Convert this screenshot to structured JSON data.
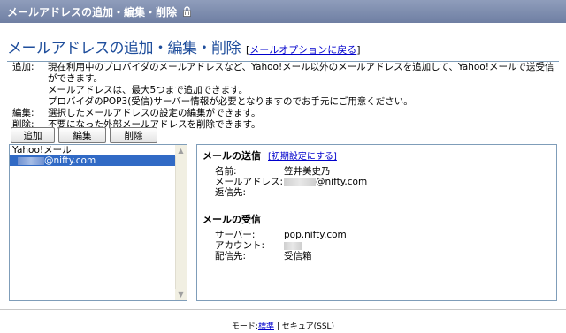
{
  "window": {
    "title": "メールアドレスの追加・編集・削除"
  },
  "heading": {
    "title": "メールアドレスの追加・編集・削除",
    "back_bracket_open": "[",
    "back_link": "メールオプションに戻る",
    "back_bracket_close": "]"
  },
  "description": [
    {
      "label": "追加:",
      "lines": [
        "現在利用中のプロバイダのメールアドレスなど、Yahoo!メール以外のメールアドレスを追加して、Yahoo!メールで送受信ができます。",
        "メールアドレスは、最大5つまで追加できます。",
        "プロバイダのPOP3(受信)サーバー情報が必要となりますのでお手元にご用意ください。"
      ]
    },
    {
      "label": "編集:",
      "lines": [
        "選択したメールアドレスの設定の編集ができます。"
      ]
    },
    {
      "label": "削除:",
      "lines": [
        "不要になった外部メールアドレスを削除できます。"
      ]
    }
  ],
  "toolbar": {
    "add_label": "追加",
    "edit_label": "編集",
    "delete_label": "削除"
  },
  "accounts": {
    "items": [
      {
        "label": "Yahoo!メール",
        "suffix": ""
      },
      {
        "label": "",
        "suffix": "@nifty.com"
      }
    ],
    "selected_index": 1
  },
  "send": {
    "title": "メールの送信",
    "reset_link": "[初期設定にする]",
    "name_label": "名前:",
    "name_value": "笠井美史乃",
    "address_label": "メールアドレス:",
    "address_value": "@nifty.com",
    "reply_label": "返信先:",
    "reply_value": ""
  },
  "receive": {
    "title": "メールの受信",
    "server_label": "サーバー:",
    "server_value": "pop.nifty.com",
    "account_label": "アカウント:",
    "account_value": "",
    "folder_label": "配信先:",
    "folder_value": "受信箱"
  },
  "footer": {
    "mode_label": "モード:",
    "standard_link": "標準",
    "separator": "|",
    "secure_label": "セキュア(SSL)"
  }
}
